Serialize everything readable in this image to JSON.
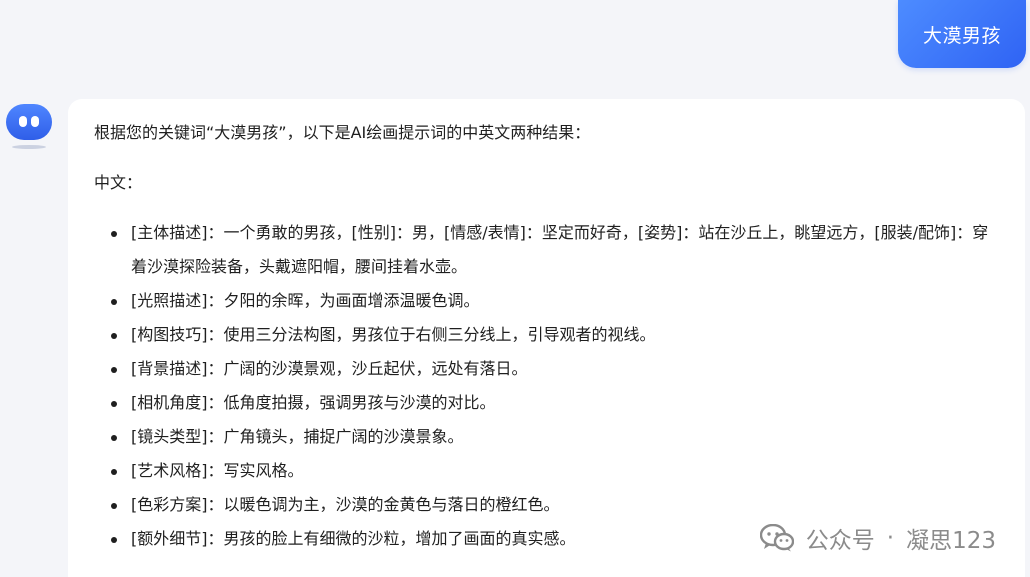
{
  "user_message": {
    "text": "大漠男孩"
  },
  "bot_message": {
    "intro": "根据您的关键词“大漠男孩”，以下是AI绘画提示词的中英文两种结果：",
    "section_label": "中文：",
    "items": [
      {
        "text": "[主体描述]：一个勇敢的男孩，[性别]：男，[情感/表情]：坚定而好奇，[姿势]：站在沙丘上，眺望远方，[服装/配饰]：穿着沙漠探险装备，头戴遮阳帽，腰间挂着水壶。"
      },
      {
        "text": "[光照描述]：夕阳的余晖，为画面增添温暖色调。"
      },
      {
        "text": "[构图技巧]：使用三分法构图，男孩位于右侧三分线上，引导观者的视线。"
      },
      {
        "text": "[背景描述]：广阔的沙漠景观，沙丘起伏，远处有落日。"
      },
      {
        "text": "[相机角度]：低角度拍摄，强调男孩与沙漠的对比。"
      },
      {
        "text": "[镜头类型]：广角镜头，捕捉广阔的沙漠景象。"
      },
      {
        "text": "[艺术风格]：写实风格。"
      },
      {
        "text": "[色彩方案]：以暖色调为主，沙漠的金黄色与落日的橙红色。"
      },
      {
        "text": "[额外细节]：男孩的脸上有细微的沙粒，增加了画面的真实感。"
      }
    ]
  },
  "watermark": {
    "source": "公众号",
    "separator": "·",
    "author": "凝思123"
  },
  "icons": {
    "avatar": "robot-avatar-icon",
    "watermark_logo": "wechat-logo-icon"
  },
  "colors": {
    "accent": "#2f63f4",
    "page_background": "#f4f5f9",
    "card_background": "#ffffff",
    "watermark": "#8b8b8b"
  }
}
